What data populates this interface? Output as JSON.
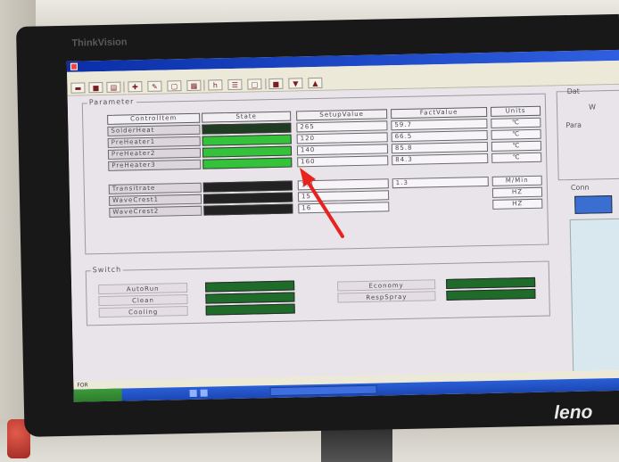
{
  "monitor": {
    "brand_top": "ThinkVision",
    "brand_bottom": "leno"
  },
  "window": {
    "title": "",
    "menus": [
      "",
      "",
      "",
      "",
      ""
    ],
    "status_text": "FOR"
  },
  "parameter_panel": {
    "group_label": "Parameter",
    "columns": [
      "ControlItem",
      "State",
      "SetupValue",
      "FactValue",
      "Units"
    ],
    "rows": [
      {
        "item": "SolderHeat",
        "state": "off",
        "setup": "265",
        "fact": "59.7",
        "unit": "℃"
      },
      {
        "item": "PreHeater1",
        "state": "on",
        "setup": "120",
        "fact": "66.5",
        "unit": "℃"
      },
      {
        "item": "PreHeater2",
        "state": "on",
        "setup": "140",
        "fact": "85.8",
        "unit": "℃"
      },
      {
        "item": "PreHeater3",
        "state": "on",
        "setup": "160",
        "fact": "84.3",
        "unit": "℃"
      }
    ],
    "rows2": [
      {
        "item": "Transitrate",
        "state": "dark",
        "setup": "1.3",
        "fact": "1.3",
        "unit": "M/Min"
      },
      {
        "item": "WaveCrest1",
        "state": "dark",
        "setup": "15",
        "fact": "",
        "unit": "HZ"
      },
      {
        "item": "WaveCrest2",
        "state": "dark",
        "setup": "16",
        "fact": "",
        "unit": "HZ"
      }
    ]
  },
  "switch_panel": {
    "group_label": "Switch",
    "left": [
      "AutoRun",
      "Clean",
      "Cooling"
    ],
    "right": [
      "Economy",
      "RespSpray"
    ]
  },
  "side_panel": {
    "label_top": "Dat",
    "label_w": "W",
    "label_para": "Para",
    "label_conn": "Conn"
  },
  "taskbar": {
    "start": "",
    "items": [
      "",
      "",
      ""
    ]
  },
  "colors": {
    "led_on": "#33c23a",
    "led_off": "#1f3b22",
    "titlebar": "#0a2fa8",
    "annotation_arrow": "#e8231f"
  }
}
